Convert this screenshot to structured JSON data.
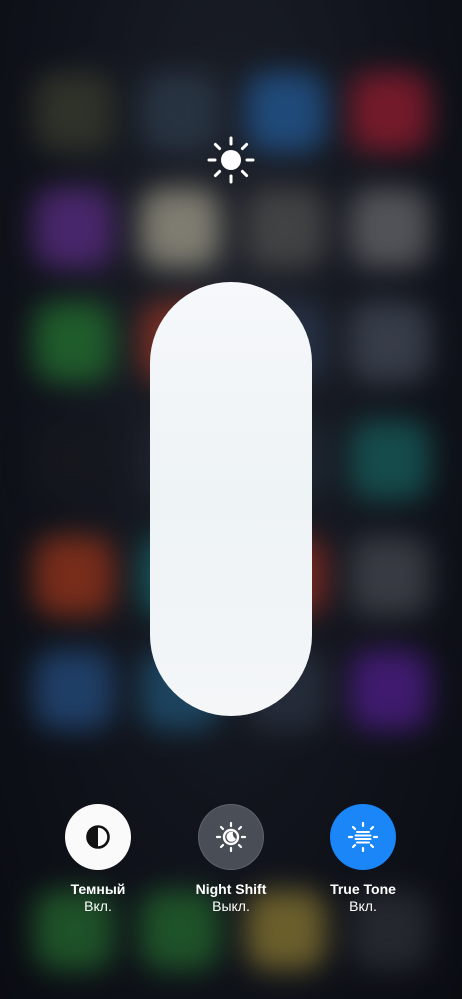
{
  "brightness": {
    "level": 1.0,
    "icon": "sun-icon"
  },
  "toggles": [
    {
      "label": "Темный",
      "state": "Вкл.",
      "icon": "dark-mode-icon",
      "active": true
    },
    {
      "label": "Night Shift",
      "state": "Выкл.",
      "icon": "night-shift-icon",
      "active": false
    },
    {
      "label": "True Tone",
      "state": "Вкл.",
      "icon": "true-tone-icon",
      "active": true
    }
  ],
  "colors": {
    "accent": "#1a86f7",
    "dark_toggle_bg": "#fafafa",
    "slider_fill": "#f4f6f8"
  }
}
